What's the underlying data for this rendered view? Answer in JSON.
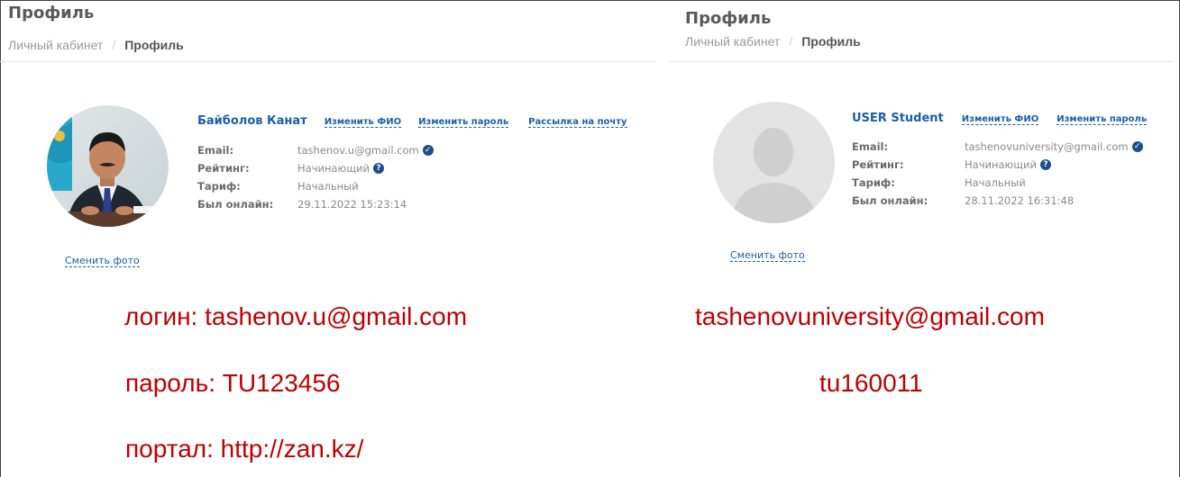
{
  "left_profile": {
    "page_title": "Профиль",
    "breadcrumb": {
      "root": "Личный кабинет",
      "separator": "/",
      "current": "Профиль"
    },
    "user_name": "Байболов Канат",
    "actions": {
      "change_name": "Изменить ФИО",
      "change_password": "Изменить пароль",
      "mailing": "Рассылка на почту"
    },
    "fields": {
      "email_label": "Email:",
      "email_value": "tashenov.u@gmail.com",
      "rating_label": "Рейтинг:",
      "rating_value": "Начинающий",
      "tariff_label": "Тариф:",
      "tariff_value": "Начальный",
      "online_label": "Был онлайн:",
      "online_value": "29.11.2022 15:23:14"
    },
    "change_photo": "Сменить фото"
  },
  "right_profile": {
    "page_title": "Профиль",
    "breadcrumb": {
      "root": "Личный кабинет",
      "separator": "/",
      "current": "Профиль"
    },
    "user_name": "USER Student",
    "actions": {
      "change_name": "Изменить ФИО",
      "change_password": "Изменить пароль"
    },
    "fields": {
      "email_label": "Email:",
      "email_value": "tashenovuniversity@gmail.com",
      "rating_label": "Рейтинг:",
      "rating_value": "Начинающий",
      "tariff_label": "Тариф:",
      "tariff_value": "Начальный",
      "online_label": "Был онлайн:",
      "online_value": "28.11.2022 16:31:48"
    },
    "change_photo": "Сменить фото"
  },
  "notes": {
    "login": "логин: tashenov.u@gmail.com",
    "password": "пароль: TU123456",
    "portal": "портал: http://zan.kz/",
    "email_2": "tashenovuniversity@gmail.com",
    "password_2": "tu160011"
  },
  "colors": {
    "link": "#1c5ea8",
    "note": "#c00000",
    "verified": "#1c4f8c"
  },
  "icons": {
    "verified": "check-circle-icon",
    "help": "question-circle-icon"
  }
}
